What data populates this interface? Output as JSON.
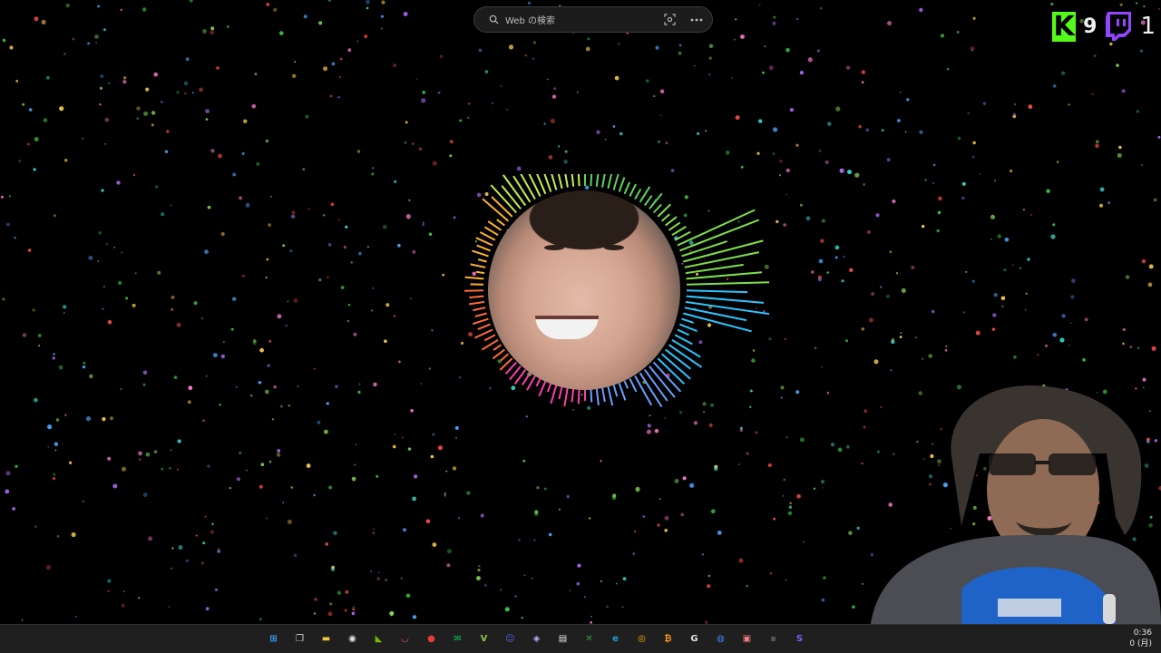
{
  "search": {
    "placeholder": "Web の検索",
    "icons": [
      "search-icon",
      "visual-search-icon",
      "more-icon"
    ]
  },
  "counters": {
    "kick": {
      "logo": "kick-logo",
      "count": "9",
      "brand_color": "#53fc18"
    },
    "twitch": {
      "logo": "twitch-logo",
      "count": "1",
      "brand_color": "#9146ff"
    }
  },
  "visualizer": {
    "colors": [
      "#5fd35a",
      "#7fe04a",
      "#2ec4ff",
      "#6aa0ff",
      "#ff3fb0",
      "#ff6a3d",
      "#ffb02e",
      "#c6f04a"
    ]
  },
  "taskbar": {
    "icons": [
      {
        "name": "start-icon",
        "color": "#3aa0ff"
      },
      {
        "name": "task-view-icon",
        "color": "#dcdcdc"
      },
      {
        "name": "file-explorer-icon",
        "color": "#f6c543"
      },
      {
        "name": "obs-icon",
        "color": "#e0e0e0"
      },
      {
        "name": "nvidia-icon",
        "color": "#76b900"
      },
      {
        "name": "lips-app-icon",
        "color": "#ff4f7a"
      },
      {
        "name": "record-icon",
        "color": "#e43c3c"
      },
      {
        "name": "line-icon",
        "color": "#06c755"
      },
      {
        "name": "v-app-icon",
        "color": "#8bc34a"
      },
      {
        "name": "discord-icon",
        "color": "#5865f2"
      },
      {
        "name": "vtuber-app-icon",
        "color": "#b0b0ff"
      },
      {
        "name": "notepad-icon",
        "color": "#e6e6e6"
      },
      {
        "name": "xbox-icon",
        "color": "#2ea043"
      },
      {
        "name": "edge-icon",
        "color": "#1fa0e0"
      },
      {
        "name": "chrome-icon",
        "color": "#f4b400"
      },
      {
        "name": "coin-app-icon",
        "color": "#f7931a"
      },
      {
        "name": "g-app-icon",
        "color": "#e0e0e0"
      },
      {
        "name": "browser-app-icon",
        "color": "#3b82f6"
      },
      {
        "name": "image-app-icon",
        "color": "#f08080"
      },
      {
        "name": "generic-app-icon",
        "color": "#555555"
      },
      {
        "name": "s-app-icon",
        "color": "#7b61ff"
      }
    ],
    "clock": {
      "time": "0:36",
      "date": "0 (月)"
    }
  }
}
